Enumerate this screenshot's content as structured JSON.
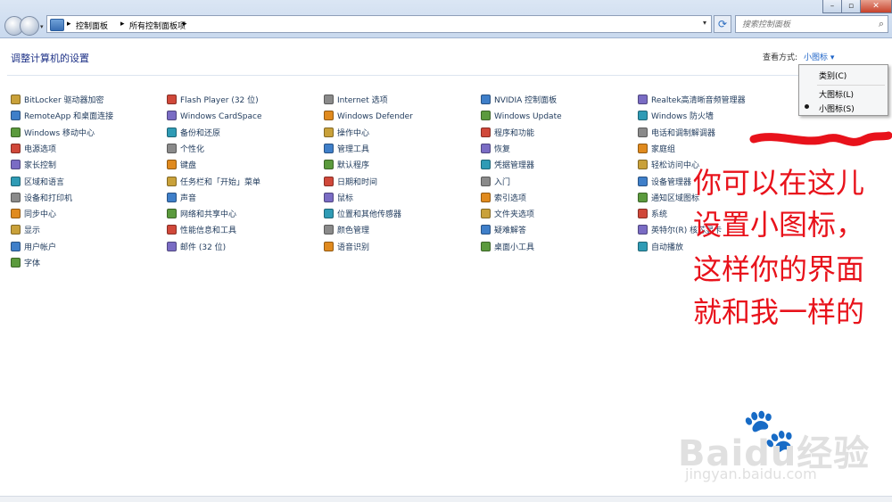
{
  "toolbar": {
    "breadcrumbs": [
      "控制面板",
      "所有控制面板项"
    ],
    "search_placeholder": "搜索控制面板",
    "refresh_icon": "refresh-icon"
  },
  "header": {
    "title": "调整计算机的设置",
    "view_label": "查看方式:",
    "view_value": "小图标"
  },
  "view_menu": {
    "items": [
      "类别(C)",
      "大图标(L)",
      "小图标(S)"
    ],
    "selected": "小图标(S)"
  },
  "columns": [
    [
      "BitLocker 驱动器加密",
      "RemoteApp 和桌面连接",
      "Windows 移动中心",
      "电源选项",
      "家长控制",
      "区域和语言",
      "设备和打印机",
      "同步中心",
      "显示",
      "用户帐户",
      "字体"
    ],
    [
      "Flash Player (32 位)",
      "Windows CardSpace",
      "备份和还原",
      "个性化",
      "键盘",
      "任务栏和「开始」菜单",
      "声音",
      "网络和共享中心",
      "性能信息和工具",
      "邮件 (32 位)"
    ],
    [
      "Internet 选项",
      "Windows Defender",
      "操作中心",
      "管理工具",
      "默认程序",
      "日期和时间",
      "鼠标",
      "位置和其他传感器",
      "颜色管理",
      "语音识别"
    ],
    [
      "NVIDIA 控制面板",
      "Windows Update",
      "程序和功能",
      "恢复",
      "凭据管理器",
      "入门",
      "索引选项",
      "文件夹选项",
      "疑难解答",
      "桌面小工具"
    ],
    [
      "Realtek高清晰音频管理器",
      "Windows 防火墙",
      "电话和调制解调器",
      "家庭组",
      "轻松访问中心",
      "设备管理器",
      "通知区域图标",
      "系统",
      "英特尔(R) 核芯显卡",
      "自动播放"
    ]
  ],
  "icon_colors": [
    "#c9a13a",
    "#3f7fc9",
    "#5b9a3d",
    "#d0483a",
    "#7a6cc4",
    "#2f9bb5",
    "#8a8a8a",
    "#e08a1e"
  ],
  "annotation": {
    "lines": [
      "你可以在这儿",
      "设置小图标，",
      "这样你的界面",
      "就和我一样的"
    ],
    "color": "#e8121b"
  },
  "watermark": {
    "brand": "Baidu经验",
    "url": "jingyan.baidu.com"
  }
}
